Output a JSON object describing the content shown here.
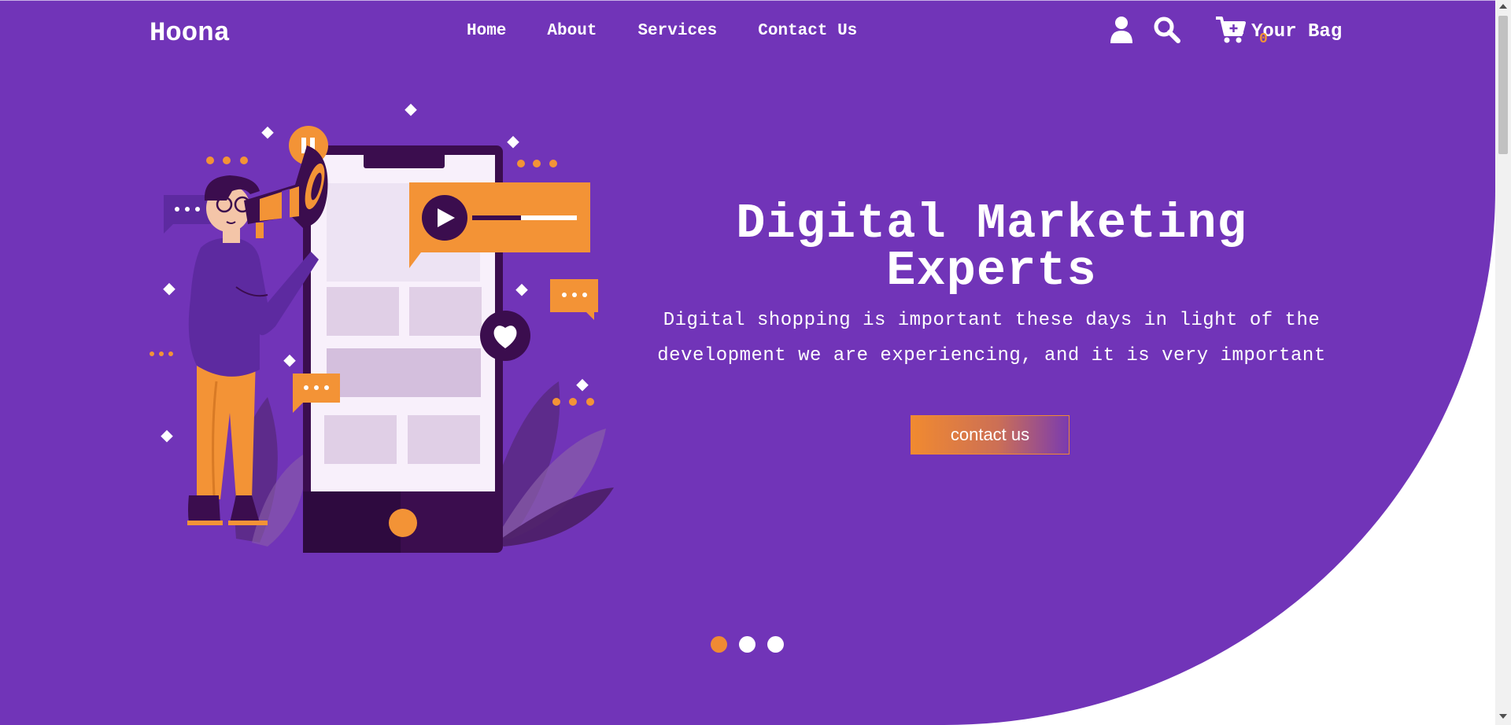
{
  "brand": {
    "name": "Hoona"
  },
  "nav": {
    "items": [
      {
        "label": "Home"
      },
      {
        "label": "About"
      },
      {
        "label": "Services"
      },
      {
        "label": "Contact Us"
      }
    ]
  },
  "header_actions": {
    "user_icon": "user-icon",
    "search_icon": "search-icon",
    "cart_icon": "cart-icon",
    "bag_label": "Your Bag",
    "bag_count": "0"
  },
  "hero": {
    "title": "Digital Marketing Experts",
    "description": "Digital shopping is important these days in light of the development we are experiencing, and it is very important",
    "cta_label": "contact us",
    "slides_total": 3,
    "active_slide": 1
  },
  "colors": {
    "primary": "#7134b8",
    "accent": "#f39336",
    "white": "#ffffff",
    "dark_purple": "#3b0d4e"
  }
}
